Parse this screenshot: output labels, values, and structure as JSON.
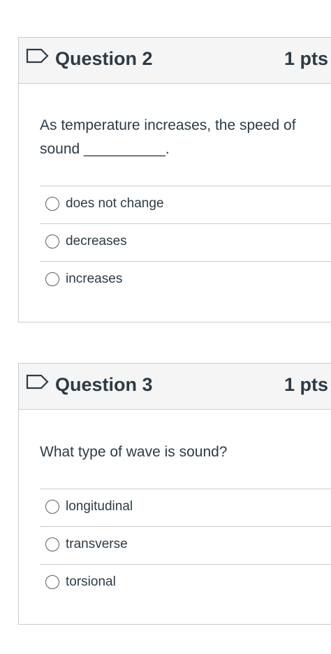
{
  "questions": [
    {
      "title": "Question 2",
      "points": "1 pts",
      "text": "As temperature increases, the speed of sound __________.",
      "answers": [
        "does not change",
        "decreases",
        "increases"
      ]
    },
    {
      "title": "Question 3",
      "points": "1 pts",
      "text": "What type of wave is sound?",
      "answers": [
        "longitudinal",
        "transverse",
        "torsional"
      ]
    }
  ],
  "colors": {
    "text": "#2d3b45",
    "border": "#c7cdd1",
    "header_bg": "#f5f5f5"
  },
  "icons": {
    "flag": "flag-outline-icon",
    "radio": "radio-unchecked-icon"
  }
}
